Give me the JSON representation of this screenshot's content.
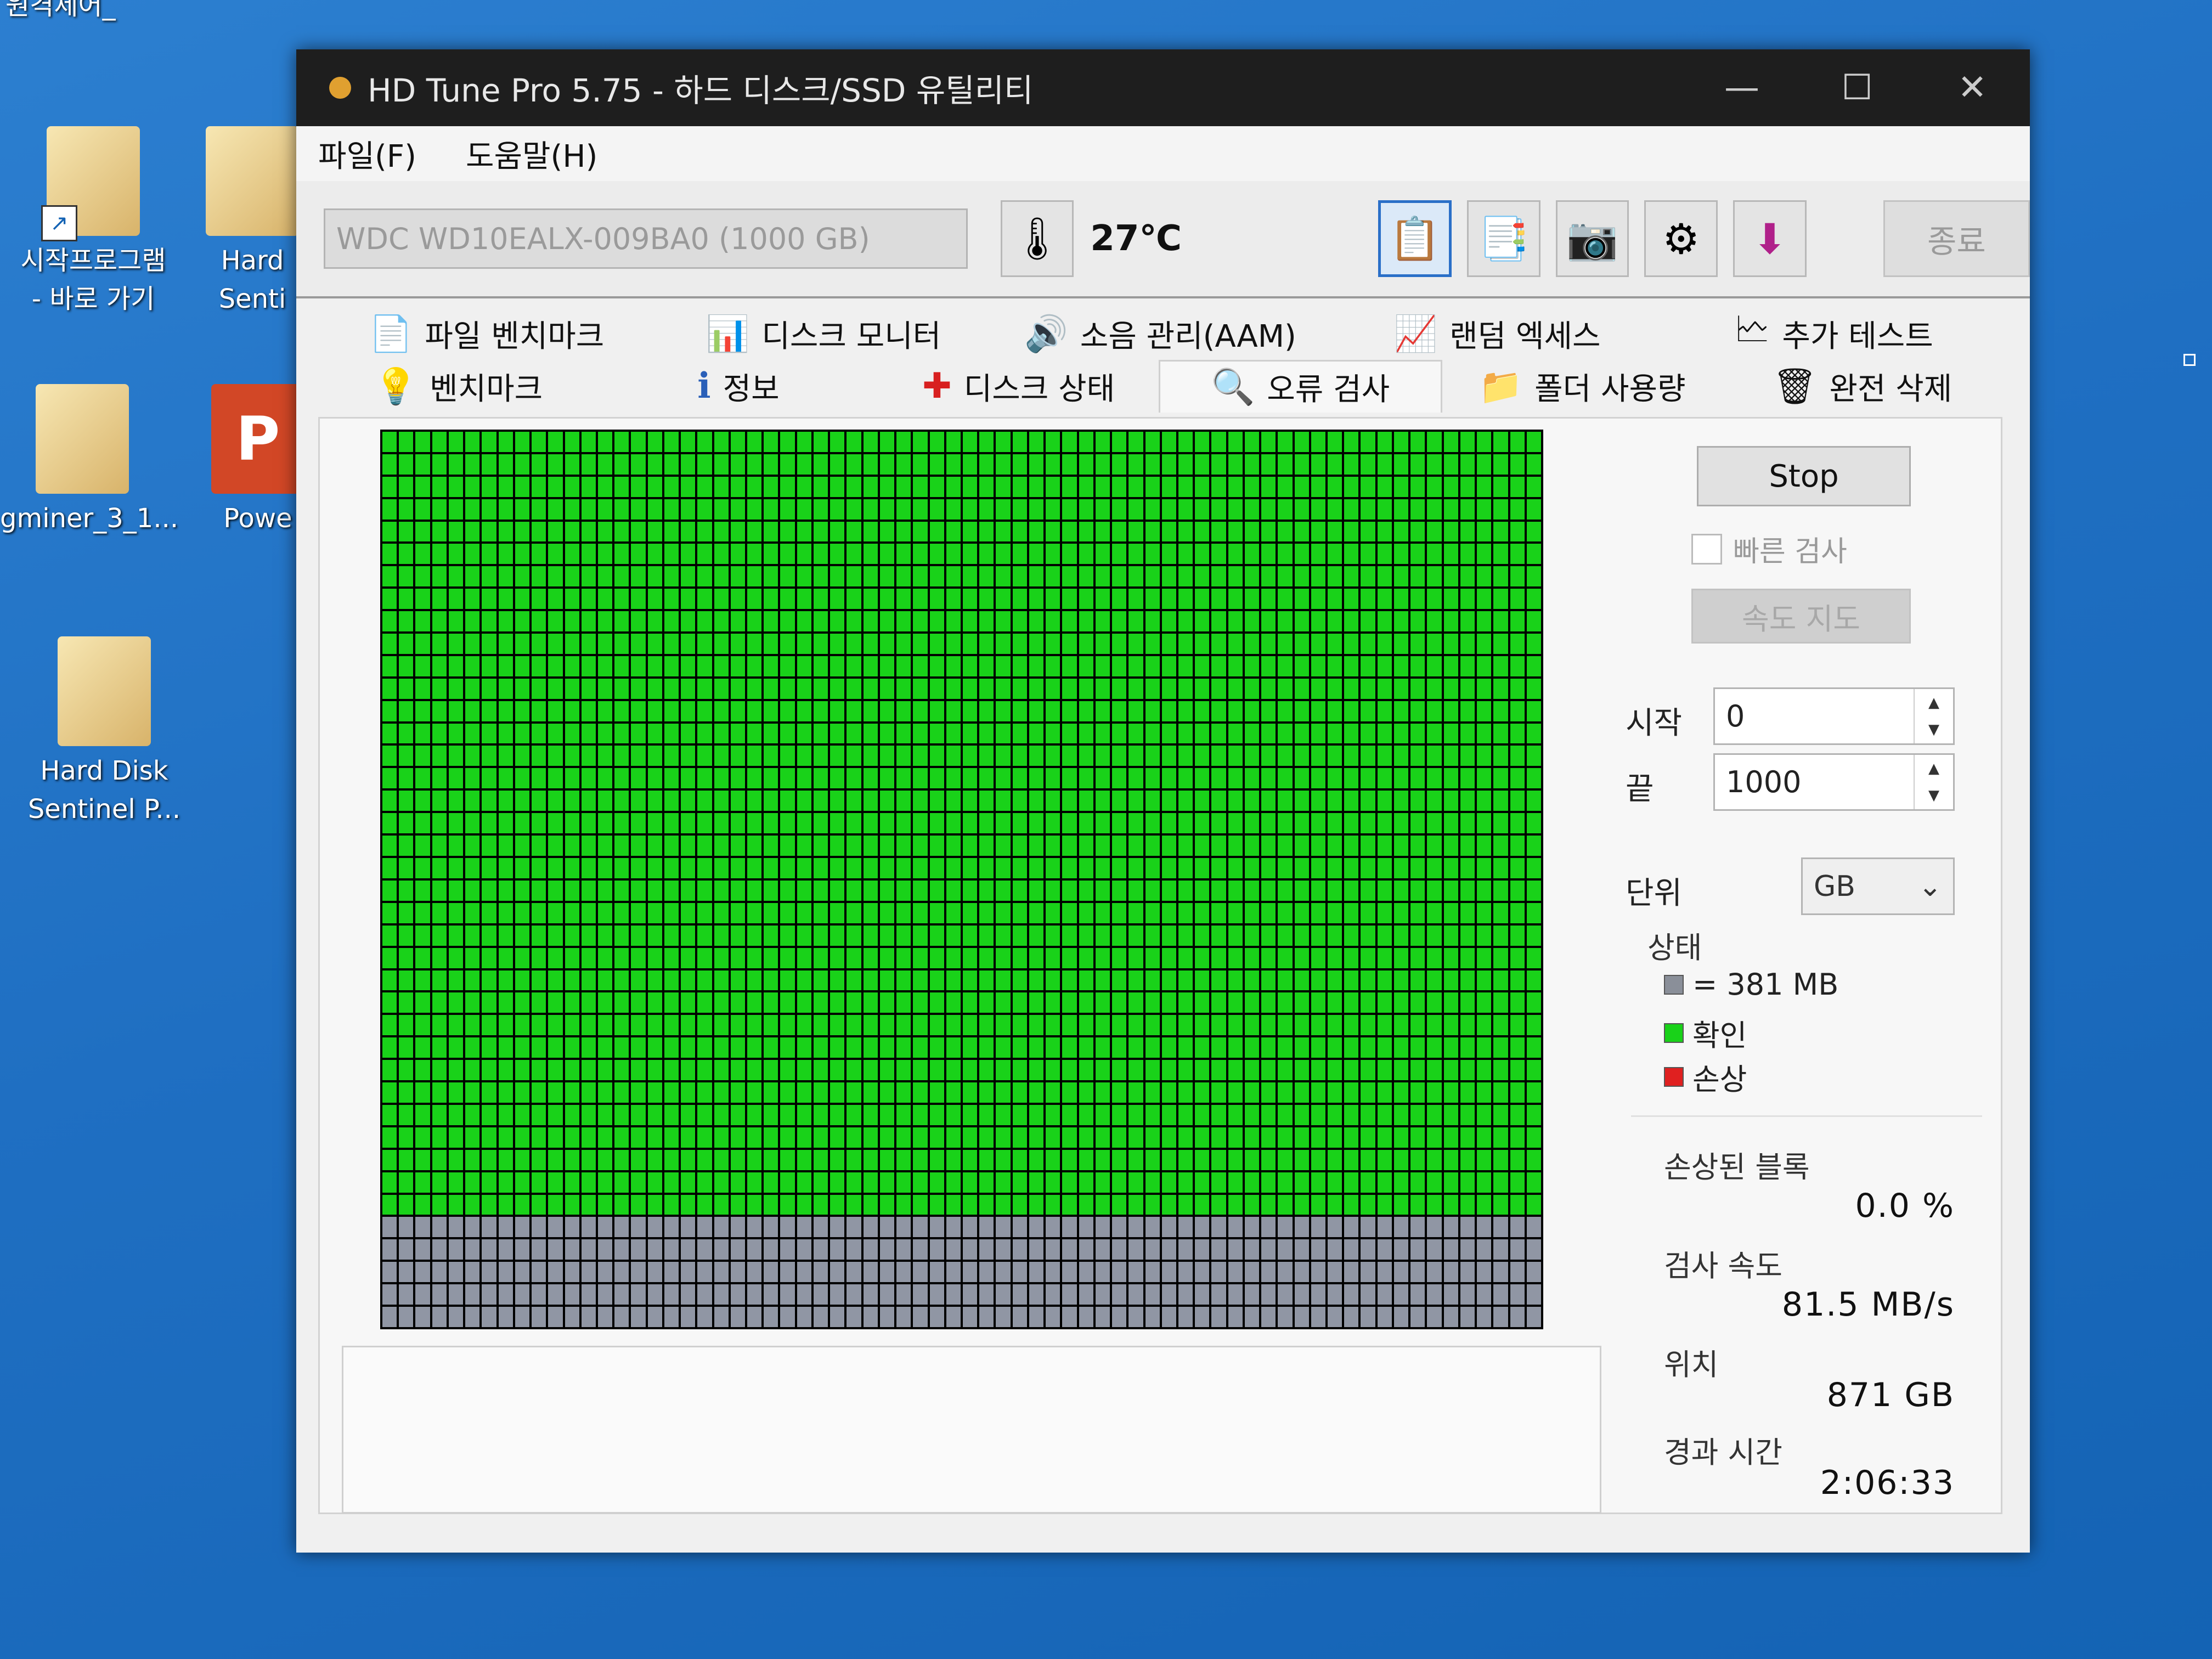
{
  "desktop": {
    "top_label": "원격제어_",
    "icons": [
      {
        "label": "시작프로그램\n- 바로 가기"
      },
      {
        "label": "Hard\nSenti"
      },
      {
        "label": "gminer_3_1..."
      },
      {
        "label": "Powe",
        "glyph": "P"
      },
      {
        "label": "Hard Disk\nSentinel P..."
      }
    ]
  },
  "window": {
    "title": "HD Tune Pro 5.75 - 하드 디스크/SSD 유틸리티",
    "controls": {
      "minimize": "—",
      "maximize": "☐",
      "close": "✕"
    }
  },
  "menu": {
    "file": "파일(F)",
    "help": "도움말(H)"
  },
  "toolbar": {
    "drive": "WDC WD10EALX-009BA0 (1000 GB)",
    "temperature": "27℃",
    "exit": "종료",
    "icons": [
      "copy-text-icon",
      "copy-info-icon",
      "screenshot-icon",
      "options-icon",
      "save-icon"
    ]
  },
  "tabs": {
    "row1": [
      "파일 벤치마크",
      "디스크 모니터",
      "소음 관리(AAM)",
      "랜덤 엑세스",
      "추가 테스트"
    ],
    "row2": [
      "벤치마크",
      "정보",
      "디스크 상태",
      "오류 검사",
      "폴더 사용량",
      "완전 삭제"
    ]
  },
  "scan": {
    "stop_label": "Stop",
    "quick_scan": "빠른 검사",
    "speed_map": "속도 지도",
    "start_label": "시작",
    "start_value": "0",
    "end_label": "끝",
    "end_value": "1000",
    "unit_label": "단위",
    "unit_value": "GB",
    "legend_title": "상태",
    "legend": [
      {
        "label": "= 381 MB",
        "color": "#8a8f99"
      },
      {
        "label": "확인",
        "color": "#19d219"
      },
      {
        "label": "손상",
        "color": "#e02020"
      }
    ],
    "damaged_label": "손상된 블록",
    "damaged_value": "0.0 %",
    "speed_label": "검사 속도",
    "speed_value": "81.5 MB/s",
    "position_label": "위치",
    "position_value": "871 GB",
    "elapsed_label": "경과 시간",
    "elapsed_value": "2:06:33",
    "grid_cells_total": 2800,
    "grid_cells_checked": 2450
  }
}
